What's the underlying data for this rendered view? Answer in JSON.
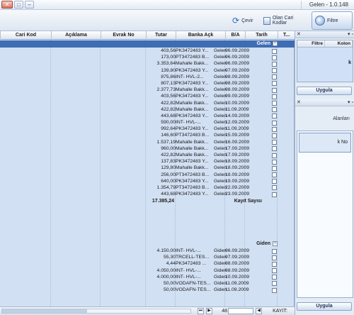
{
  "window": {
    "title": "Gelen - 1.0.148"
  },
  "toolbar": {
    "filter_label": "Filtre",
    "close_label": "Olan Cari Kodlar",
    "cevir_label": "Çevir"
  },
  "grid": {
    "columns": [
      "T...",
      "Tarih",
      "B/A",
      "Banka Açk",
      "Tutar",
      "Evrak No",
      "Açıklama",
      "Cari Kod"
    ],
    "groups": {
      "gelen": "Gelen",
      "giden": "Giden"
    },
    "gelen_rows": [
      {
        "date": "06.09.2009",
        "type": "Gelen",
        "bank": "PK3472483 Y...",
        "amt": "403,56"
      },
      {
        "date": "06.09.2009",
        "type": "Gelen",
        "bank": "PT3472483 B...",
        "amt": "173,00"
      },
      {
        "date": "06.09.2009",
        "type": "Gelen",
        "bank": "Mahalle Bakk...",
        "amt": "3.353,64"
      },
      {
        "date": "07.09.2009",
        "type": "Gelen",
        "bank": "PK3472483 Y...",
        "amt": "139,80"
      },
      {
        "date": "08.09.2009",
        "type": "Gelen",
        "bank": "INT-    HVL-2...",
        "amt": "875,86"
      },
      {
        "date": "08.09.2009",
        "type": "Gelen",
        "bank": "PK3472483 Y...",
        "amt": "807,13"
      },
      {
        "date": "08.09.2009",
        "type": "Gelen",
        "bank": "Mahalle Bakk...",
        "amt": "2.377,73"
      },
      {
        "date": "09.09.2009",
        "type": "Gelen",
        "bank": "PK3472483 Y...",
        "amt": "403,56"
      },
      {
        "date": "10.09.2009",
        "type": "Gelen",
        "bank": "Mahalle Bakk...",
        "amt": "422,82"
      },
      {
        "date": "11.09.2009",
        "type": "Gelen",
        "bank": "Mahalle Bakk...",
        "amt": "422,82"
      },
      {
        "date": "14.09.2009",
        "type": "Gelen",
        "bank": "PK3472483 Y...",
        "amt": "443,68"
      },
      {
        "date": "12.09.2009",
        "type": "Gelen",
        "bank": "INT-    HVL-...",
        "amt": "590,00"
      },
      {
        "date": "11.09.2009",
        "type": "Gelen",
        "bank": "PK3472483 Y...",
        "amt": "992,64"
      },
      {
        "date": "15.09.2009",
        "type": "Gelen",
        "bank": "PT3472483 B...",
        "amt": "146,60"
      },
      {
        "date": "16.09.2009",
        "type": "Gelen",
        "bank": "Mahalle Bakk...",
        "amt": "1.537,19"
      },
      {
        "date": "17.09.2009",
        "type": "Gelen",
        "bank": "Mahalle Bakk...",
        "amt": "960,00"
      },
      {
        "date": "17.09.2009",
        "type": "Gelen",
        "bank": "Mahalle Bakk...",
        "amt": "422,82"
      },
      {
        "date": "18.09.2009",
        "type": "Gelen",
        "bank": "PK3472483 Y...",
        "amt": "137,83"
      },
      {
        "date": "18.09.2009",
        "type": "Gelen",
        "bank": "Mahalle Bakk...",
        "amt": "129,80"
      },
      {
        "date": "18.09.2009",
        "type": "Gelen",
        "bank": "PT3472483 B...",
        "amt": "256,00"
      },
      {
        "date": "19.09.2009",
        "type": "Gelen",
        "bank": "PK3472483 Y...",
        "amt": "640,00"
      },
      {
        "date": "22.09.2009",
        "type": "Gelen",
        "bank": "PT3472483 B...",
        "amt": "1.354,79"
      },
      {
        "date": "23.09.2009",
        "type": "Gelen",
        "bank": "PK3472483 Y...",
        "amt": "443,68"
      }
    ],
    "summary": {
      "label": "Kayıt Sayısı",
      "value": "17.385,24"
    },
    "giden_rows": [
      {
        "date": "06.09.2009",
        "type": "Giden",
        "bank": "INT-    HVL-...",
        "amt": "4.150,00"
      },
      {
        "date": "07.09.2009",
        "type": "Giden",
        "bank": "TRCELL-TES...",
        "amt": "55,30"
      },
      {
        "date": "08.09.2009",
        "type": "Giden",
        "bank": "PK3472483 ...",
        "amt": "4,44"
      },
      {
        "date": "08.09.2009",
        "type": "Giden",
        "bank": "INT-    HVL-...",
        "amt": "4.050,00"
      },
      {
        "date": "10.09.2009",
        "type": "Giden",
        "bank": "INT-    HVL-...",
        "amt": "4.000,00"
      },
      {
        "date": "11.09.2009",
        "type": "Giden",
        "bank": "VODAFN-TES...",
        "amt": "50,00"
      },
      {
        "date": "11.09.2009",
        "type": "Giden",
        "bank": "VODAFN-TES...",
        "amt": "50,00"
      }
    ]
  },
  "nav": {
    "label": "KAYIT:",
    "count": "48"
  },
  "sidebar": {
    "grid_cols": [
      "Filtre",
      "Kolon"
    ],
    "grid_selected": "k",
    "apply_label": "Uygula",
    "alanlar_label": "Alanları",
    "evrak_label": "k No",
    "apply2_label": "Uygula"
  }
}
